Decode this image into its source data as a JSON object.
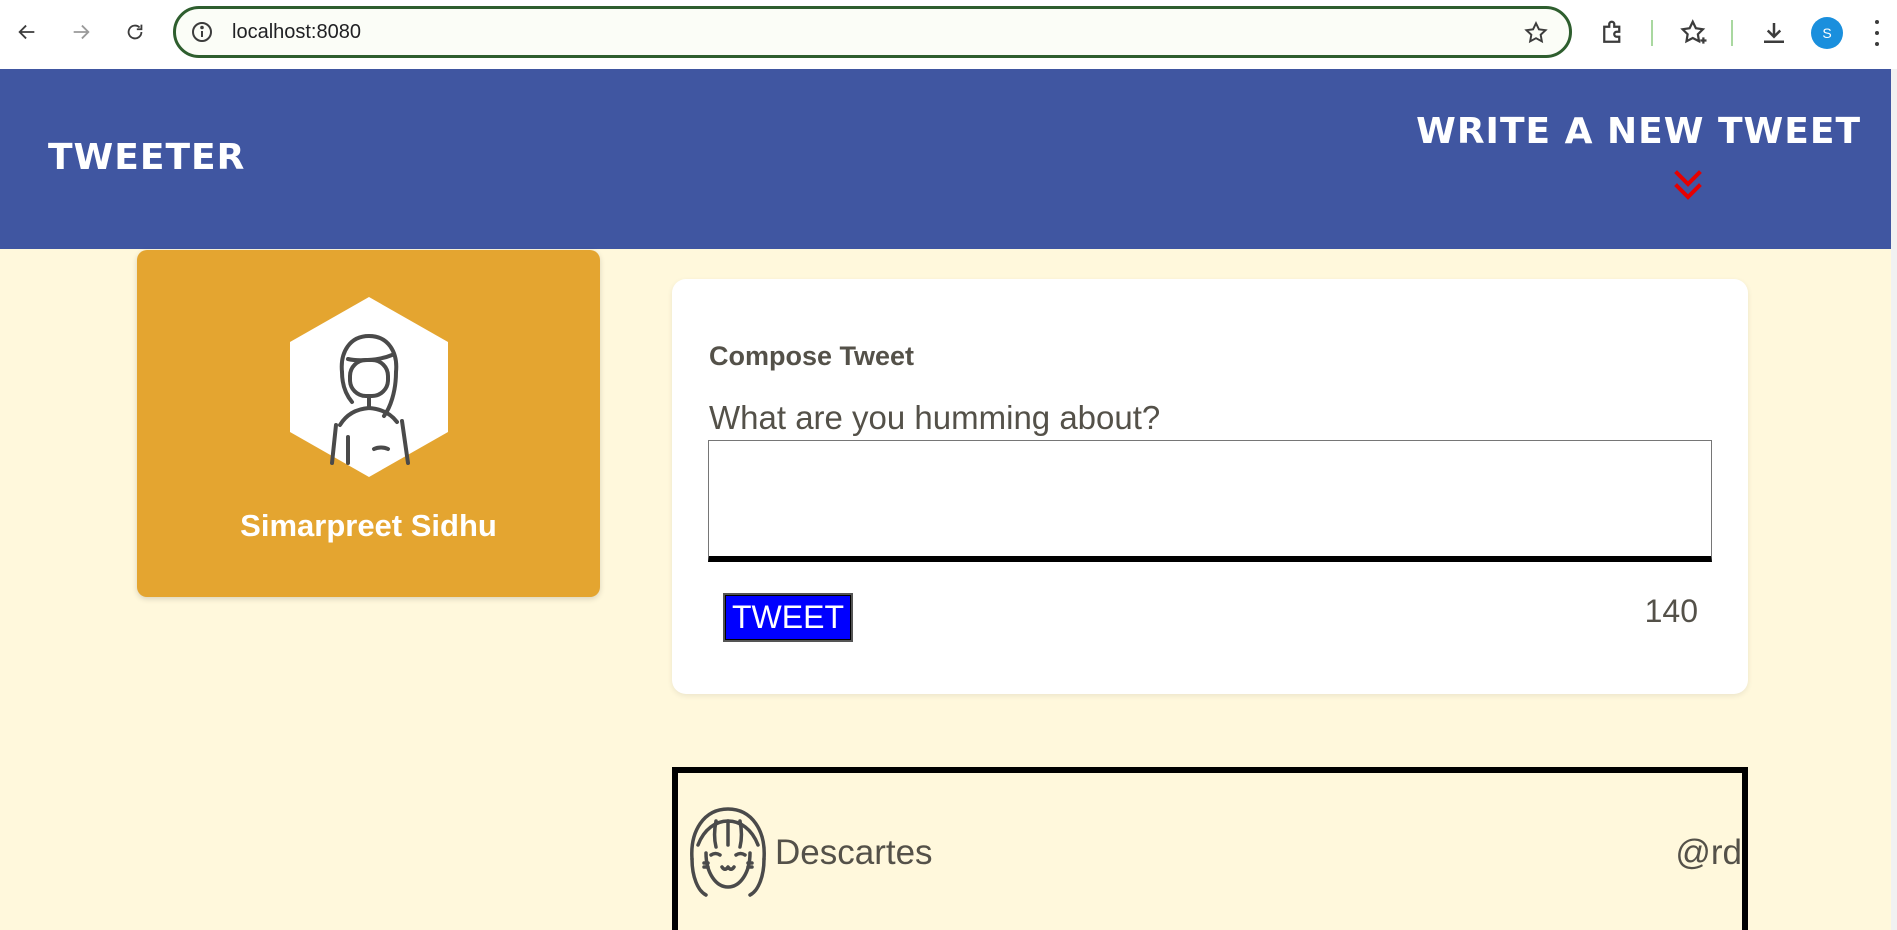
{
  "browser": {
    "url": "localhost:8080",
    "profile_initial": "S",
    "icons": [
      "back-icon",
      "forward-icon",
      "reload-icon",
      "info-icon",
      "bookmark-star-icon",
      "extensions-icon",
      "favorites-icon",
      "download-icon",
      "menu-icon"
    ]
  },
  "header": {
    "brand": "TWEETER",
    "write_new": "WRITE A NEW TWEET",
    "accent_color": "#e60000",
    "background": "#4056a1"
  },
  "profile": {
    "name": "Simarpreet Sidhu",
    "card_color": "#e4a530"
  },
  "compose": {
    "title": "Compose Tweet",
    "label": "What are you humming about?",
    "textarea_value": "",
    "button_label": "TWEET",
    "counter": "140"
  },
  "tweets": [
    {
      "name": "Descartes",
      "handle": "@rd"
    }
  ]
}
